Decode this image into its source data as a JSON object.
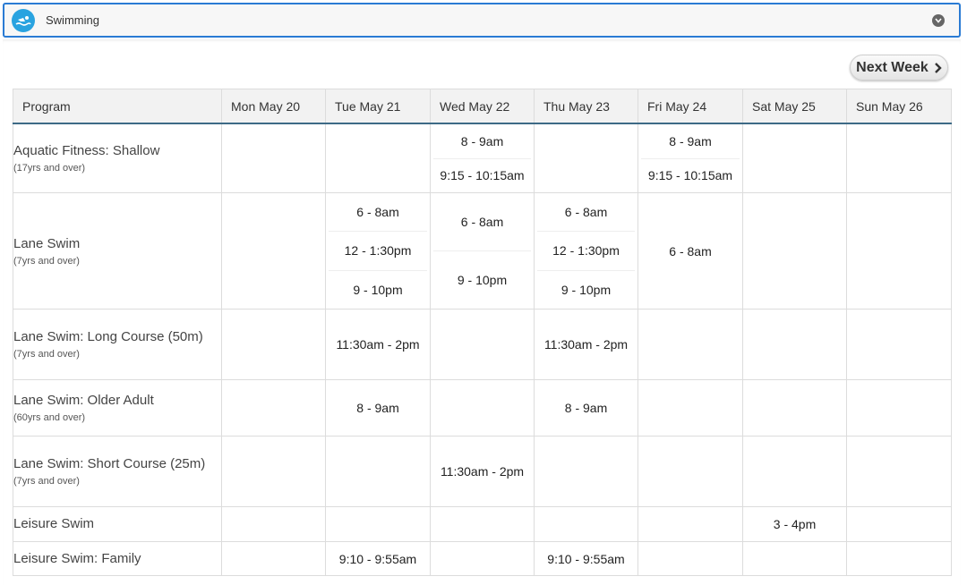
{
  "accordion": {
    "title": "Swimming",
    "icon": "swimmer-icon",
    "toggle_icon": "chevron-down-icon"
  },
  "nav": {
    "next_week_label": "Next Week"
  },
  "table": {
    "columns": [
      "Program",
      "Mon May 20",
      "Tue May 21",
      "Wed May 22",
      "Thu May 23",
      "Fri May 24",
      "Sat May 25",
      "Sun May 26"
    ],
    "rows": [
      {
        "name": "Aquatic Fitness: Shallow",
        "age": "(17yrs and over)",
        "days": [
          [],
          [],
          [
            "8 - 9am",
            "9:15 - 10:15am"
          ],
          [],
          [
            "8 - 9am",
            "9:15 - 10:15am"
          ],
          [],
          []
        ]
      },
      {
        "name": "Lane Swim",
        "age": "(7yrs and over)",
        "days": [
          [],
          [
            "6 - 8am",
            "12 - 1:30pm",
            "9 - 10pm"
          ],
          [
            "6 - 8am",
            "9 - 10pm"
          ],
          [
            "6 - 8am",
            "12 - 1:30pm",
            "9 - 10pm"
          ],
          [
            "6 - 8am"
          ],
          [],
          []
        ]
      },
      {
        "name": "Lane Swim: Long Course (50m)",
        "age": "(7yrs and over)",
        "days": [
          [],
          [
            "11:30am - 2pm"
          ],
          [],
          [
            "11:30am - 2pm"
          ],
          [],
          [],
          []
        ]
      },
      {
        "name": "Lane Swim: Older Adult",
        "age": "(60yrs and over)",
        "days": [
          [],
          [
            "8 - 9am"
          ],
          [],
          [
            "8 - 9am"
          ],
          [],
          [],
          []
        ]
      },
      {
        "name": "Lane Swim: Short Course (25m)",
        "age": "(7yrs and over)",
        "days": [
          [],
          [],
          [
            "11:30am - 2pm"
          ],
          [],
          [],
          [],
          []
        ]
      },
      {
        "name": "Leisure Swim",
        "age": "",
        "days": [
          [],
          [],
          [],
          [],
          [],
          [
            "3 - 4pm"
          ],
          []
        ]
      },
      {
        "name": "Leisure Swim: Family",
        "age": "",
        "days": [
          [],
          [
            "9:10 - 9:55am"
          ],
          [],
          [
            "9:10 - 9:55am"
          ],
          [],
          [],
          []
        ]
      }
    ]
  },
  "colors": {
    "accent": "#2a7bd4",
    "icon_bg": "#29a3e0",
    "header_border": "#3d6a86"
  }
}
